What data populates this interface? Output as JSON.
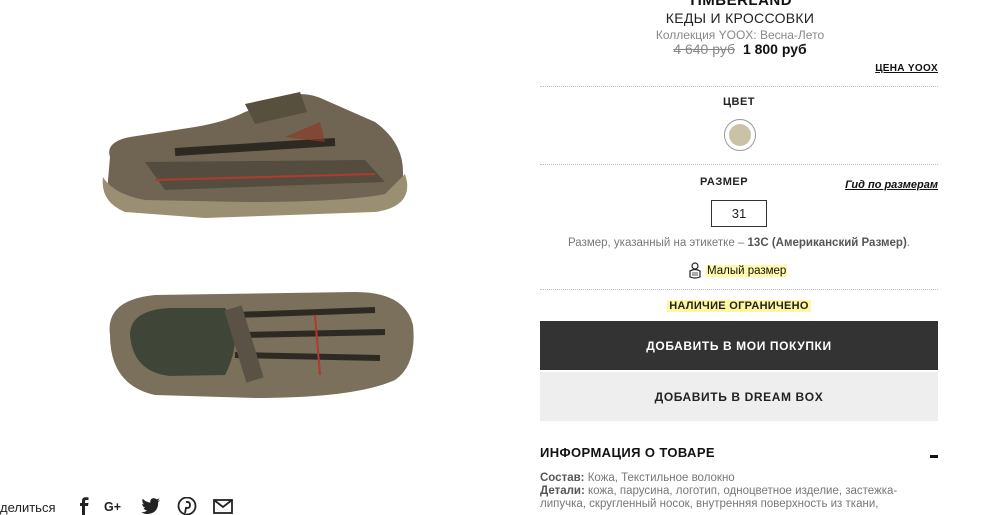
{
  "product": {
    "brand": "TIMBERLAND",
    "category": "КЕДЫ И КРОССОВКИ",
    "collection": "Коллекция YOOX: Весна-Лето",
    "old_price": "4 640 руб",
    "new_price": "1 800 руб",
    "price_link": "ЦЕНА YOOX"
  },
  "color": {
    "label": "ЦВЕТ",
    "swatch_color": "#c9c2a6"
  },
  "size": {
    "label": "РАЗМЕР",
    "guide_link": "Гид по размерам",
    "selected": "31",
    "note_prefix": "Размер, указанный на этикетке – ",
    "note_value": "13C (Американский Размер)",
    "note_suffix": ".",
    "fit_label": "Малый размер"
  },
  "availability": "НАЛИЧИЕ ОГРАНИЧЕНО",
  "buttons": {
    "add_to_cart": "ДОБАВИТЬ В МОИ ПОКУПКИ",
    "add_to_dreambox": "ДОБАВИТЬ В DREAM BOX"
  },
  "info": {
    "title": "ИНФОРМАЦИЯ О ТОВАРЕ",
    "composition_label": "Состав:",
    "composition": " Кожа, Текстильное волокно",
    "details_label": "Детали:",
    "details": " кожа, парусина, логотип, одноцветное изделие, застежка-липучка, скругленный носок, внутренняя поверхность из ткани,"
  },
  "share": {
    "label": "делиться",
    "networks": [
      "facebook-icon",
      "google-plus-icon",
      "twitter-icon",
      "pinterest-icon",
      "email-icon"
    ]
  },
  "colors": {
    "primary_button": "#333333",
    "secondary_button": "#eeeeee",
    "highlight": "#fffaa8"
  }
}
